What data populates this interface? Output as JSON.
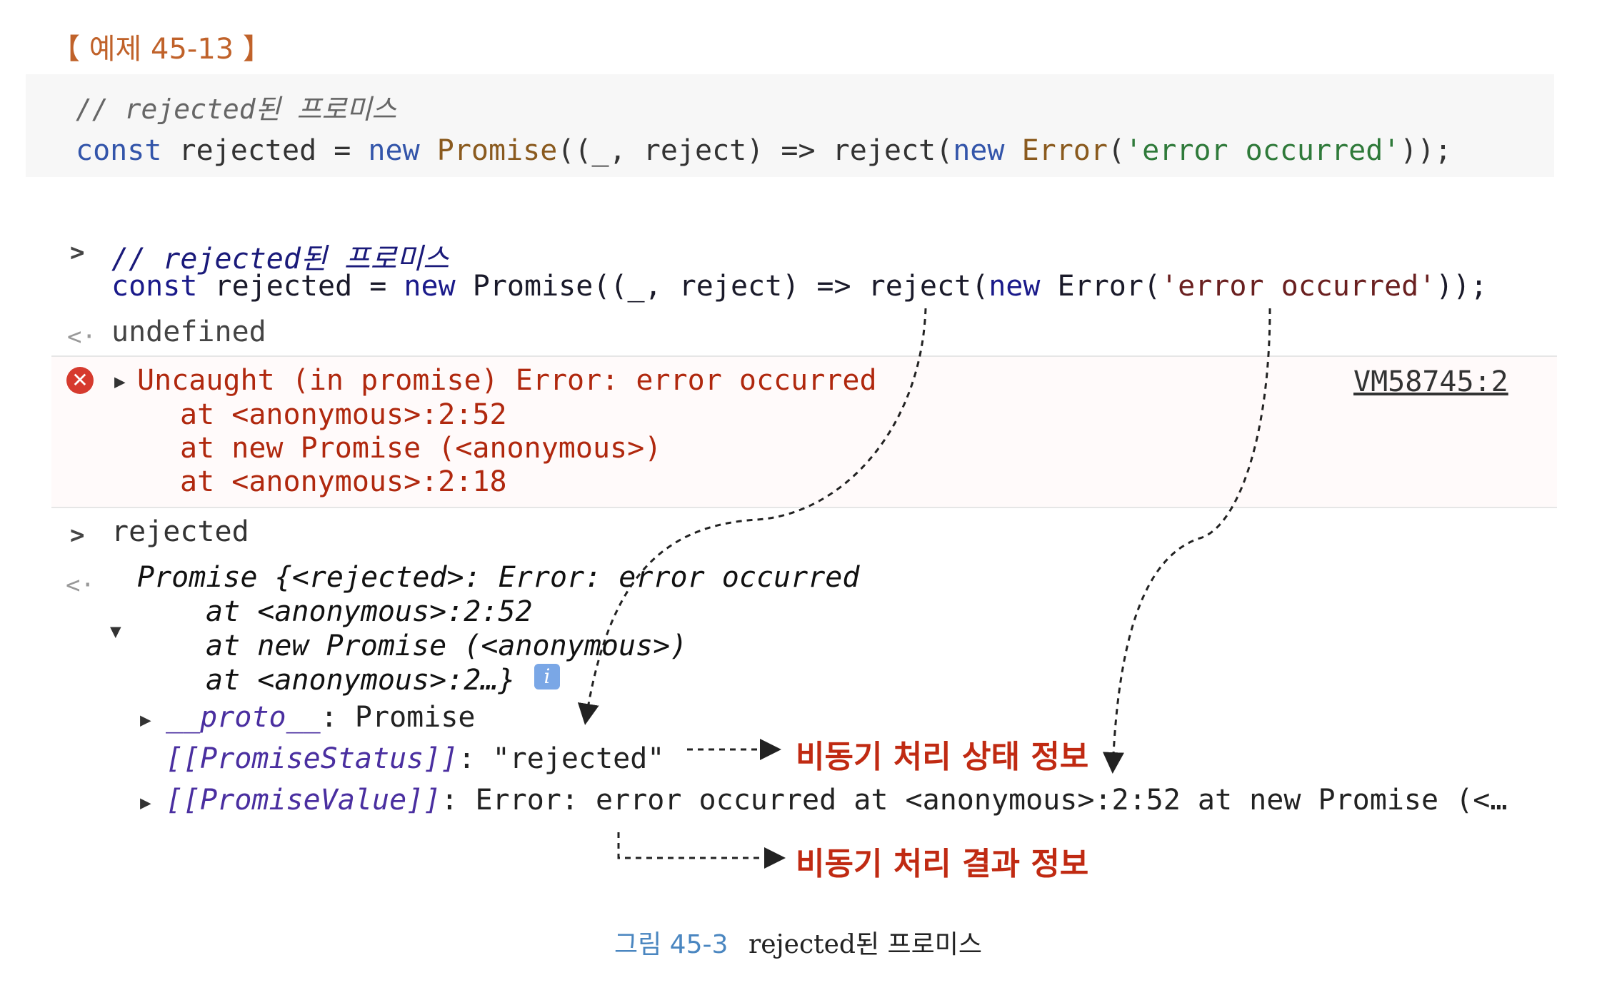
{
  "example_label": "【 예제 45-13 】",
  "code": {
    "comment": "// rejected된 프로미스",
    "line_parts": {
      "p1": "const",
      "p2": " rejected = ",
      "p3": "new",
      "p4": " ",
      "p5": "Promise",
      "p6": "((_, reject) => reject(",
      "p7": "new",
      "p8": " ",
      "p9": "Error",
      "p10": "(",
      "p11": "'error occurred'",
      "p12": "));"
    }
  },
  "console": {
    "input_prompt": ">",
    "return_prompt": "<·",
    "comment": "// rejected된 프로미스",
    "code_parts": {
      "p1": "const",
      "p2": " rejected = ",
      "p3": "new",
      "p4": " Promise((_, reject) => reject(",
      "p5": "new",
      "p6": " Error(",
      "p7": "'error occurred'",
      "p8": "));"
    },
    "undefined": "undefined",
    "error": {
      "icon": "error-x-icon",
      "message": "Uncaught (in promise) Error: error occurred",
      "stack": [
        "at <anonymous>:2:52",
        "at new Promise (<anonymous>)",
        "at <anonymous>:2:18"
      ],
      "source_link": "VM58745:2"
    },
    "input2": "rejected",
    "promise_summary": "Promise {<rejected>: Error: error occurred",
    "promise_stack": [
      "at <anonymous>:2:52",
      "at new Promise (<anonymous>)",
      "at <anonymous>:2…}"
    ],
    "info_icon_letter": "i",
    "proto_key": "__proto__",
    "proto_value": ": Promise",
    "status_key": "[[PromiseStatus]]",
    "status_value": ": \"rejected\"",
    "value_key": "[[PromiseValue]]",
    "value_value": ": Error: error occurred at <anonymous>:2:52 at new Promise (<…"
  },
  "annotations": {
    "status": "비동기 처리 상태 정보",
    "result": "비동기 처리 결과 정보"
  },
  "caption": {
    "number": "그림 45-3",
    "text": "rejected된 프로미스"
  },
  "colors": {
    "error_red": "#c02a12",
    "label_orange": "#c0622a",
    "caption_blue": "#4a86c0"
  }
}
